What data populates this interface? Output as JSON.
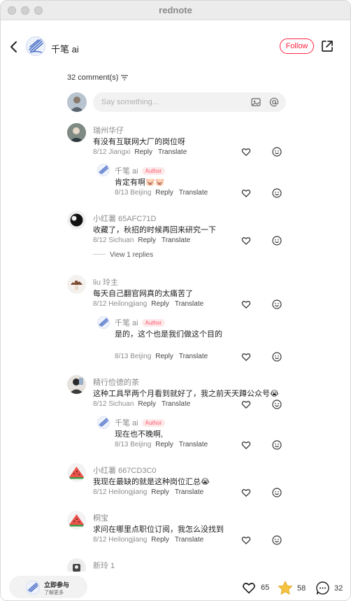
{
  "window": {
    "title": "rednote"
  },
  "header": {
    "author": "千笔 ai",
    "follow_label": "Follow"
  },
  "comments_header": {
    "count_label": "32 comment(s)"
  },
  "input": {
    "placeholder": "Say something..."
  },
  "actions": {
    "reply": "Reply",
    "translate": "Translate",
    "view_replies": "View 1 replies"
  },
  "comments": [
    {
      "name": "瑞州华仔",
      "text": "有没有互联网大厂的岗位呀",
      "meta": "8/12 Jiangxi"
    },
    {
      "name": "千笔 ai",
      "author_tag": "Author",
      "text": "肯定有啊🐷🐷",
      "meta": "8/13 Beijing"
    },
    {
      "name": "小红薯 65AFC71D",
      "text": "收藏了，秋招的时候再回来研究一下",
      "meta": "8/12 Sichuan"
    },
    {
      "name": "liu 玲主",
      "text": "每天自己翻官网真的太痛苦了",
      "meta": "8/12 Heilongjiang"
    },
    {
      "name": "千笔 ai",
      "author_tag": "Author",
      "text": "是的，这个也是我们做这个目的",
      "meta": "8/13 Beijing"
    },
    {
      "name": "精行俭德的茶",
      "text": "这种工具早两个月看到就好了，我之前天天蹲公众号😭",
      "meta": "8/12 Sichuan"
    },
    {
      "name": "千笔 ai",
      "author_tag": "Author",
      "text": "现在也不晚啊,",
      "meta": "8/13 Beijing"
    },
    {
      "name": "小红薯 667CD3C0",
      "text": "我现在最缺的就是这种岗位汇总😭",
      "meta": "8/12 Heilongjiang"
    },
    {
      "name": "桐宝",
      "text": "求问在哪里点职位订阅，我怎么没找到",
      "meta": "8/12 Heilongjiang"
    },
    {
      "name": "新玲 1",
      "text": "",
      "meta": ""
    }
  ],
  "bottom_bar": {
    "cta_main": "立即参与",
    "cta_sub": "了解更多",
    "likes": "65",
    "stars": "58",
    "comments": "32"
  },
  "colors": {
    "accent": "#ff2442",
    "star": "#f5c242"
  }
}
